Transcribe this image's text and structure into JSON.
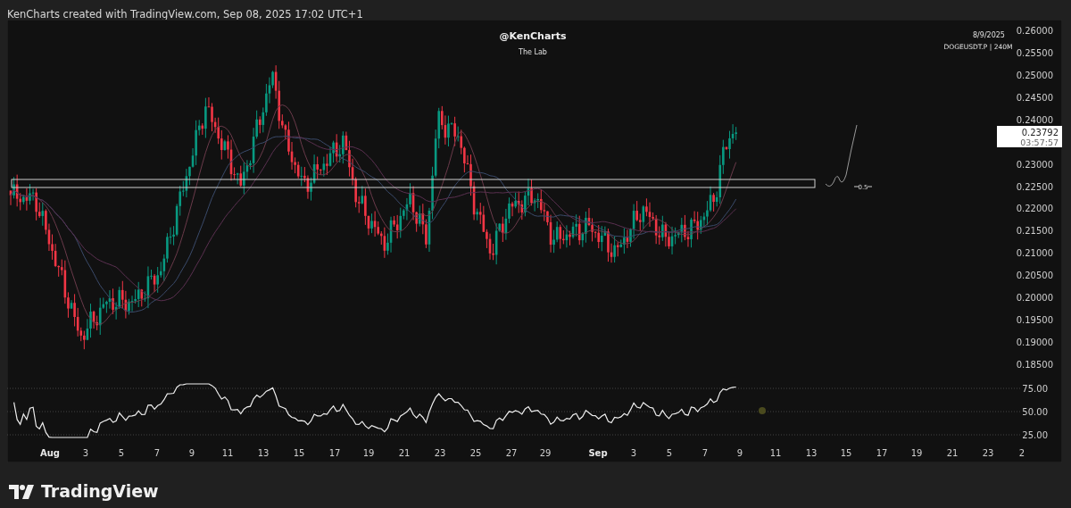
{
  "header": {
    "caption": "KenCharts created with TradingView.com, Sep 08, 2025 17:02 UTC+1"
  },
  "chart": {
    "title": "@KenCharts",
    "subtitle": "The Lab",
    "date": "8/9/2025",
    "symbol": "DOGEUSDT.P | 240M",
    "price_axis": [
      "0.26000",
      "0.25500",
      "0.25000",
      "0.24500",
      "0.24000",
      "0.23000",
      "0.22500",
      "0.22000",
      "0.21500",
      "0.21000",
      "0.20500",
      "0.20000",
      "0.19500",
      "0.19000",
      "0.18500"
    ],
    "last_price": "0.23792",
    "countdown": "03:57:57",
    "fib_label": "0.5",
    "rsi_axis": [
      "75.00",
      "50.00",
      "25.00"
    ],
    "time_axis": [
      {
        "label": "Aug",
        "kind": "month"
      },
      {
        "label": "3",
        "kind": "day"
      },
      {
        "label": "5",
        "kind": "day"
      },
      {
        "label": "7",
        "kind": "day"
      },
      {
        "label": "9",
        "kind": "day"
      },
      {
        "label": "11",
        "kind": "day"
      },
      {
        "label": "13",
        "kind": "day"
      },
      {
        "label": "15",
        "kind": "day"
      },
      {
        "label": "17",
        "kind": "day"
      },
      {
        "label": "19",
        "kind": "day"
      },
      {
        "label": "21",
        "kind": "day"
      },
      {
        "label": "23",
        "kind": "day"
      },
      {
        "label": "25",
        "kind": "day"
      },
      {
        "label": "27",
        "kind": "day"
      },
      {
        "label": "29",
        "kind": "day"
      },
      {
        "label": "Sep",
        "kind": "month"
      },
      {
        "label": "3",
        "kind": "day"
      },
      {
        "label": "5",
        "kind": "day"
      },
      {
        "label": "7",
        "kind": "day"
      },
      {
        "label": "9",
        "kind": "day"
      },
      {
        "label": "11",
        "kind": "day"
      },
      {
        "label": "13",
        "kind": "day"
      },
      {
        "label": "15",
        "kind": "day"
      },
      {
        "label": "17",
        "kind": "day"
      },
      {
        "label": "19",
        "kind": "day"
      },
      {
        "label": "21",
        "kind": "day"
      },
      {
        "label": "23",
        "kind": "day"
      },
      {
        "label": "2",
        "kind": "day"
      }
    ]
  },
  "footer": {
    "brand": "TradingView"
  }
}
